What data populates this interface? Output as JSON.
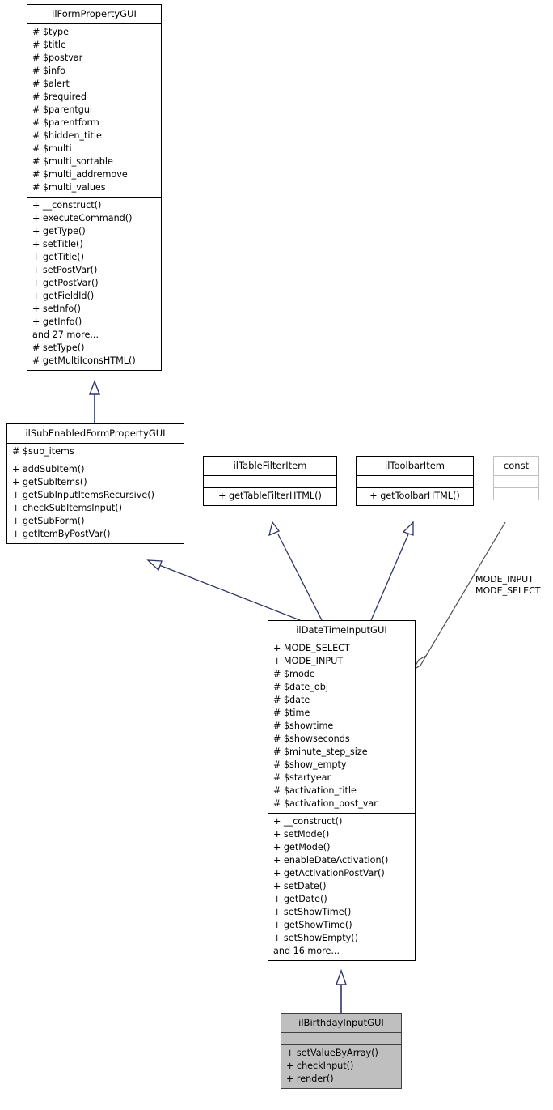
{
  "diagram": {
    "type": "uml-class-inheritance-diagram",
    "background": "#ffffff",
    "edge_color": "#2e3566",
    "assoc_color": "#4d4d4d",
    "highlight_fill": "#bfbfbf"
  },
  "classes": {
    "form_property_gui": {
      "name": "ilFormPropertyGUI",
      "attributes": [
        "# $type",
        "# $title",
        "# $postvar",
        "# $info",
        "# $alert",
        "# $required",
        "# $parentgui",
        "# $parentform",
        "# $hidden_title",
        "# $multi",
        "# $multi_sortable",
        "# $multi_addremove",
        "# $multi_values"
      ],
      "methods": [
        "+ __construct()",
        "+ executeCommand()",
        "+ getType()",
        "+ setTitle()",
        "+ getTitle()",
        "+ setPostVar()",
        "+ getPostVar()",
        "+ getFieldId()",
        "+ setInfo()",
        "+ getInfo()",
        "and 27 more...",
        "# setType()",
        "# getMultiIconsHTML()"
      ]
    },
    "sub_enabled_form_property_gui": {
      "name": "ilSubEnabledFormPropertyGUI",
      "attributes": [
        "# $sub_items"
      ],
      "methods": [
        "+ addSubItem()",
        "+ getSubItems()",
        "+ getSubInputItemsRecursive()",
        "+ checkSubItemsInput()",
        "+ getSubForm()",
        "+ getItemByPostVar()"
      ]
    },
    "table_filter_item": {
      "name": "ilTableFilterItem",
      "attributes": [],
      "methods": [
        "+ getTableFilterHTML()"
      ]
    },
    "toolbar_item": {
      "name": "ilToolbarItem",
      "attributes": [],
      "methods": [
        "+ getToolbarHTML()"
      ]
    },
    "const_node": {
      "name": "const",
      "attributes": [],
      "methods": []
    },
    "date_time_input_gui": {
      "name": "ilDateTimeInputGUI",
      "attributes": [
        "+ MODE_SELECT",
        "+ MODE_INPUT",
        "# $mode",
        "# $date_obj",
        "# $date",
        "# $time",
        "# $showtime",
        "# $showseconds",
        "# $minute_step_size",
        "# $show_empty",
        "# $startyear",
        "# $activation_title",
        "# $activation_post_var"
      ],
      "methods": [
        "+ __construct()",
        "+ setMode()",
        "+ getMode()",
        "+ enableDateActivation()",
        "+ getActivationPostVar()",
        "+ setDate()",
        "+ getDate()",
        "+ setShowTime()",
        "+ getShowTime()",
        "+ setShowEmpty()",
        "and 16 more..."
      ]
    },
    "birthday_input_gui": {
      "name": "ilBirthdayInputGUI",
      "attributes": [],
      "methods": [
        "+ setValueByArray()",
        "+ checkInput()",
        "+ render()"
      ]
    }
  },
  "edge_labels": {
    "const_association": "MODE_INPUT\nMODE_SELECT",
    "const_association_line1": "MODE_INPUT",
    "const_association_line2": "MODE_SELECT"
  }
}
